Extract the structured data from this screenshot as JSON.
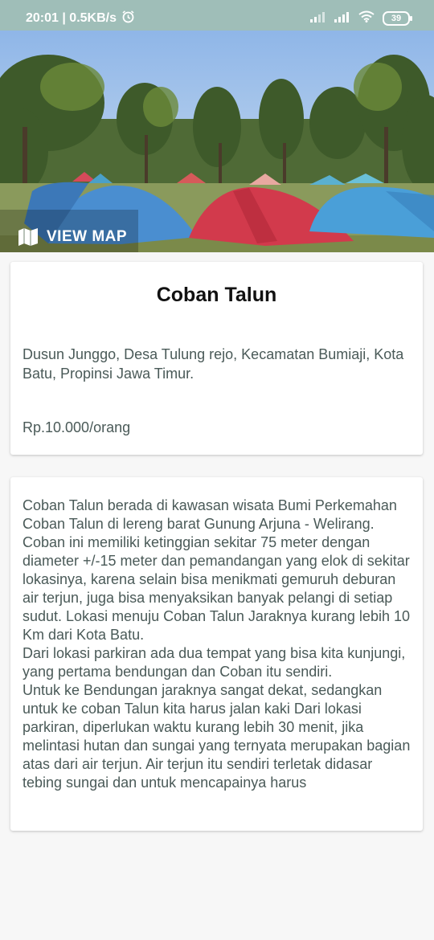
{
  "status_bar": {
    "time_speed": "20:01 | 0.5KB/s",
    "battery": "39",
    "alarm_icon": "alarm-icon",
    "signal_icon": "signal-icon",
    "wifi_icon": "wifi-icon"
  },
  "hero": {
    "view_map_label": "VIEW MAP",
    "map_icon": "map-icon"
  },
  "place": {
    "title": "Coban Talun",
    "address": "Dusun Junggo, Desa Tulung rejo, Kecamatan Bumiaji, Kota Batu, Propinsi Jawa Timur.",
    "price": "Rp.10.000/orang"
  },
  "description": "Coban Talun berada di kawasan wisata Bumi Perkemahan Coban Talun di lereng barat Gunung Arjuna - Welirang. Coban ini memiliki ketinggian sekitar 75 meter dengan diameter +/-15 meter dan pemandangan yang elok di sekitar lokasinya, karena selain bisa menikmati gemuruh deburan air terjun, juga bisa menyaksikan banyak pelangi di setiap sudut. Lokasi menuju Coban Talun Jaraknya kurang lebih 10 Km dari Kota Batu.\nDari lokasi parkiran ada dua tempat yang bisa kita kunjungi, yang pertama bendungan dan Coban itu sendiri.\nUntuk ke Bendungan jaraknya sangat dekat, sedangkan untuk ke coban Talun kita harus jalan kaki Dari lokasi parkiran, diperlukan waktu kurang lebih 30 menit, jika melintasi hutan dan sungai yang ternyata merupakan bagian atas dari air terjun. Air terjun itu sendiri terletak didasar tebing sungai dan untuk mencapainya harus"
}
